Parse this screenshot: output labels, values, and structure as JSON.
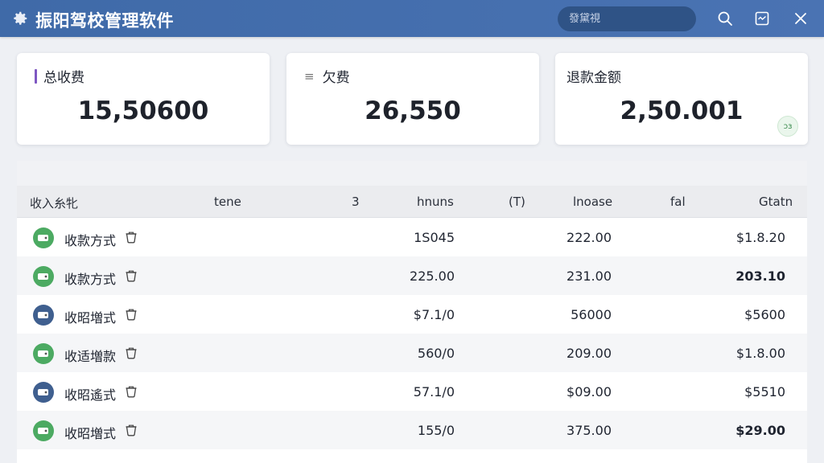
{
  "app": {
    "title": "振阳驾校管理软件"
  },
  "search": {
    "placeholder": "發黛視"
  },
  "header_icons": [
    "search-icon",
    "chart-window-icon",
    "close-icon"
  ],
  "stats": [
    {
      "label": "总收费",
      "value": "15,50600",
      "marker": "accent-bar",
      "accent_color": "#7e57c2"
    },
    {
      "label": "欠费",
      "value": "26,550",
      "marker": "≡"
    },
    {
      "label": "退款金额",
      "value": "2,50.001",
      "badge": "ɔɜ"
    }
  ],
  "table": {
    "headers": [
      "收入糸牝",
      "tene",
      "3",
      "hnuns",
      "(T)",
      "lnoase",
      "fal",
      "Gtatn"
    ],
    "rows": [
      {
        "label": "收款方式",
        "icon_color": "green",
        "a": "1S045",
        "b": "222.00",
        "c": "$1.8.20",
        "c_bold": false
      },
      {
        "label": "收款方式",
        "icon_color": "green",
        "a": "225.00",
        "b": "231.00",
        "c": "203.10",
        "c_bold": true
      },
      {
        "label": "收昭増式",
        "icon_color": "blue",
        "a": "$7.1/0",
        "b": "56000",
        "c": "$5600",
        "c_bold": false
      },
      {
        "label": "收适増款",
        "icon_color": "green",
        "a": "560/0",
        "b": "209.00",
        "c": "$1.8.00",
        "c_bold": false
      },
      {
        "label": "收昭遙式",
        "icon_color": "blue",
        "a": "57.1/0",
        "b": "$09.00",
        "c": "$5510",
        "c_bold": false
      },
      {
        "label": "收昭増式",
        "icon_color": "green",
        "a": "155/0",
        "b": "375.00",
        "c": "$29.00",
        "c_bold": true
      }
    ]
  },
  "colors": {
    "header": "#4a73b3",
    "accent": "#7e57c2",
    "icon_green": "#4caa62",
    "icon_blue": "#3f5f8f"
  }
}
